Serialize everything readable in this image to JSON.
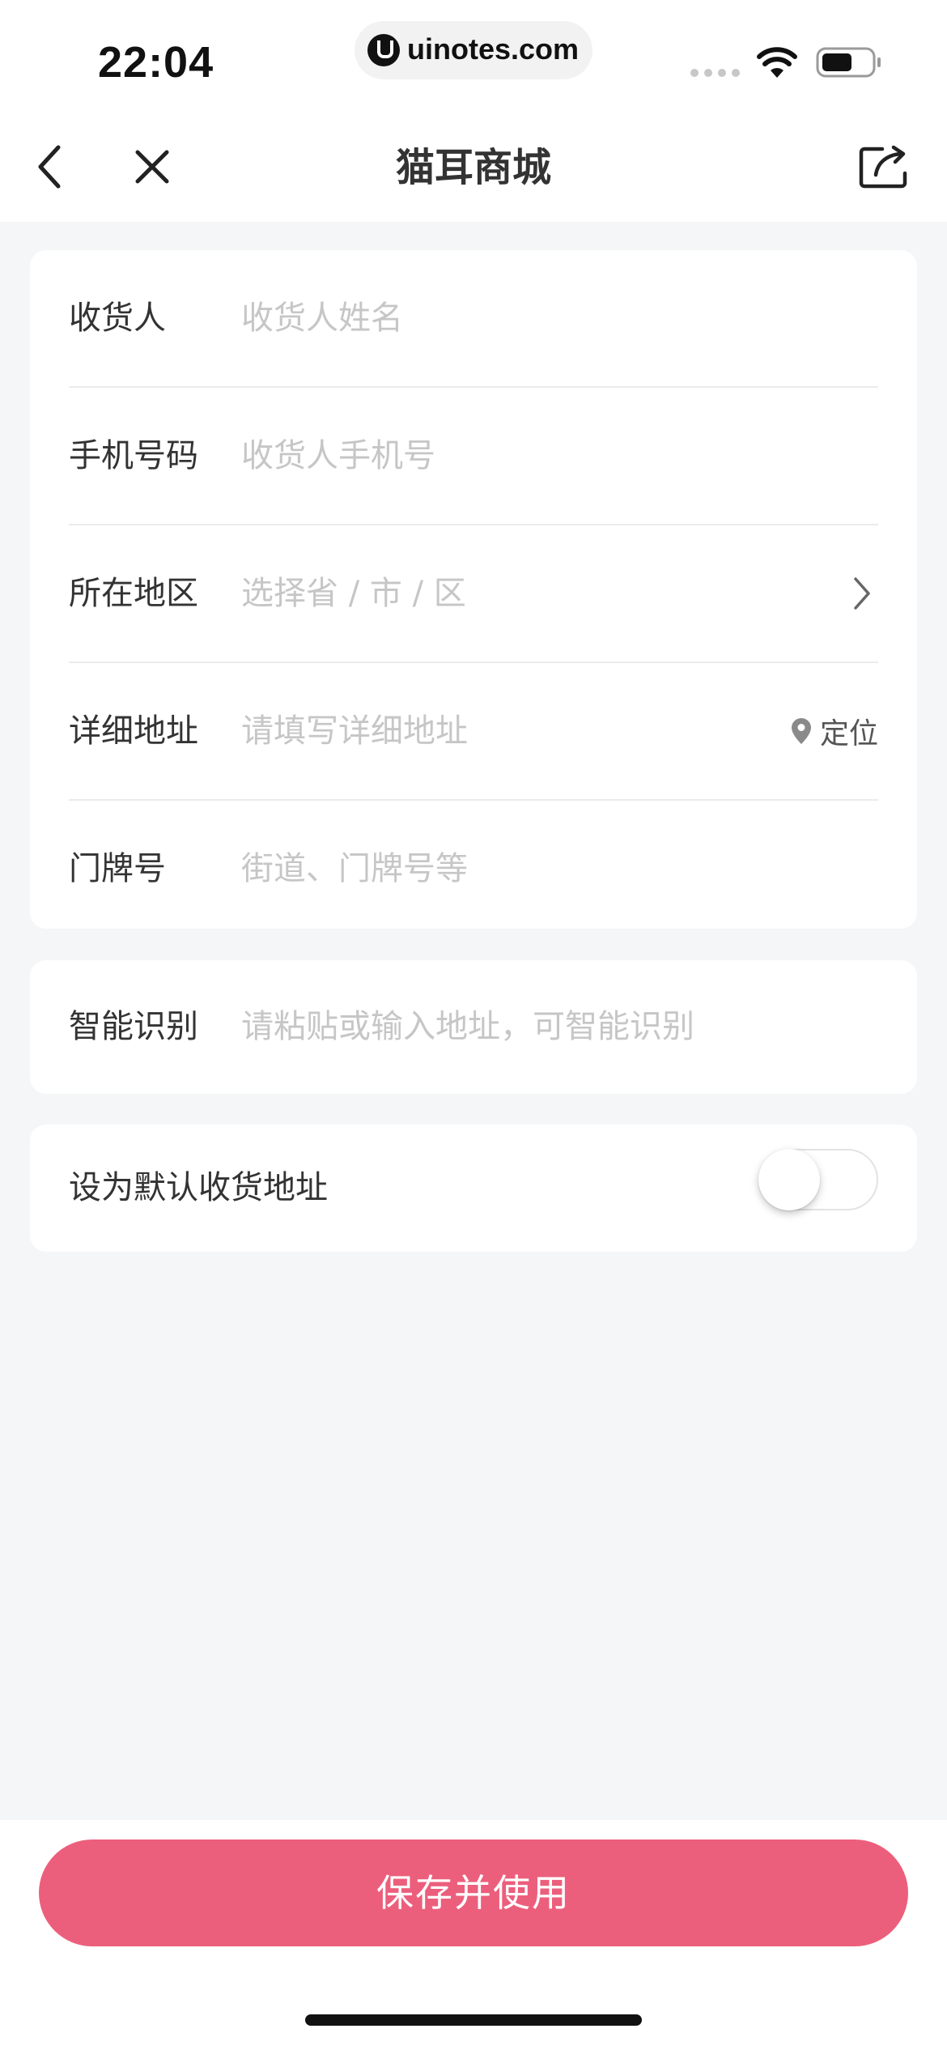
{
  "status_bar": {
    "time": "22:04",
    "url": "uinotes.com"
  },
  "nav": {
    "title": "猫耳商城",
    "back_icon": "chevron-left-icon",
    "close_icon": "close-icon",
    "share_icon": "share-icon"
  },
  "address_form": {
    "recipient": {
      "label": "收货人",
      "placeholder": "收货人姓名",
      "value": ""
    },
    "phone": {
      "label": "手机号码",
      "placeholder": "收货人手机号",
      "value": ""
    },
    "region": {
      "label": "所在地区",
      "placeholder": "选择省 / 市 / 区",
      "value": ""
    },
    "detail": {
      "label": "详细地址",
      "placeholder": "请填写详细地址",
      "value": "",
      "locate_label": "定位"
    },
    "house_number": {
      "label": "门牌号",
      "placeholder": "街道、门牌号等",
      "value": ""
    }
  },
  "smart_recognition": {
    "label": "智能识别",
    "placeholder": "请粘贴或输入地址，可智能识别",
    "value": ""
  },
  "default_address": {
    "label": "设为默认收货地址",
    "enabled": false
  },
  "actions": {
    "save_label": "保存并使用"
  },
  "colors": {
    "accent": "#ec5f7c",
    "background": "#f5f6f8",
    "placeholder": "#c6c6c6",
    "text": "#333333"
  }
}
